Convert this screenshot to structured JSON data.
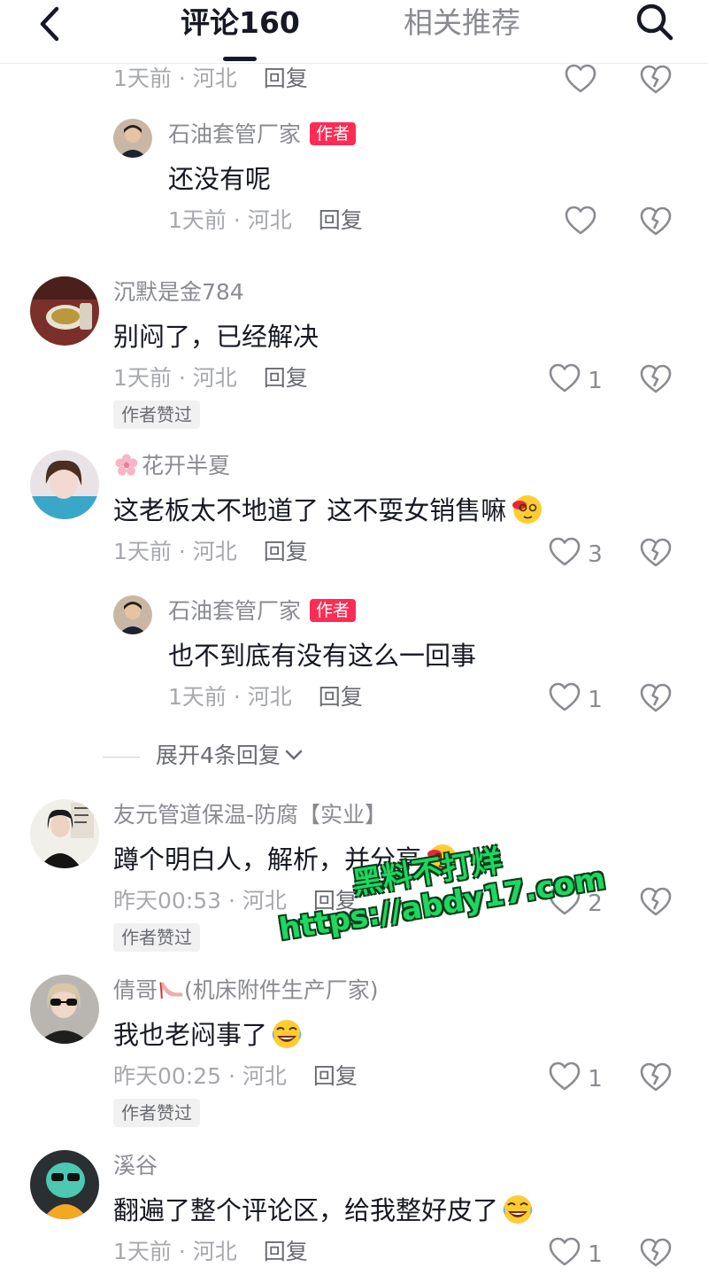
{
  "header": {
    "back_icon": "chevron-left-icon",
    "tab_comments": "评论160",
    "tab_related": "相关推荐",
    "search_icon": "search-icon"
  },
  "colors": {
    "author_badge": "#fe2c55",
    "text_primary": "#161823",
    "text_secondary": "#8a8b91",
    "watermark_fill": "#1ed760"
  },
  "top_partial": {
    "time": "1天前 · 河北",
    "reply_label": "回复"
  },
  "comments": [
    {
      "username": "石油套管厂家",
      "author_badge": "作者",
      "text": "还没有呢",
      "time": "1天前 · 河北",
      "reply_label": "回复",
      "likes": "",
      "is_reply": true
    },
    {
      "username": "沉默是金784",
      "text": "别闷了，已经解决",
      "time": "1天前 · 河北",
      "reply_label": "回复",
      "likes": "1",
      "liked_by_author": "作者赞过"
    },
    {
      "username_prefix_icon": "cherry-blossom-emoji",
      "username": "花开半夏",
      "text": "这老板太不地道了  这不耍女销售嘛",
      "text_emoji": "dizzy-face-emoji",
      "time": "1天前 · 河北",
      "reply_label": "回复",
      "likes": "3"
    },
    {
      "username": "石油套管厂家",
      "author_badge": "作者",
      "text": "也不到底有没有这么一回事",
      "time": "1天前 · 河北",
      "reply_label": "回复",
      "likes": "1",
      "is_reply": true
    },
    {
      "username": "友元管道保温-防腐【实业】",
      "text": "蹲个明白人，解析，并分享",
      "text_emoji": "dizzy-face-emoji",
      "time": "昨天00:53 · 河北",
      "reply_label": "回复",
      "likes": "2",
      "liked_by_author": "作者赞过"
    },
    {
      "username": "倩哥",
      "username_icon": "high-heel-emoji",
      "username_suffix": "(机床附件生产厂家)",
      "text": "我也老闷事了",
      "text_emoji": "rolling-laughing-emoji",
      "time": "昨天00:25 · 河北",
      "reply_label": "回复",
      "likes": "1",
      "liked_by_author": "作者赞过"
    },
    {
      "username": "溪谷",
      "text": "翻遍了整个评论区，给我整好皮了",
      "text_emoji": "rolling-laughing-emoji",
      "time": "1天前 · 河北",
      "reply_label": "回复",
      "likes": "1"
    }
  ],
  "expand_replies": "展开4条回复",
  "watermark": {
    "line1": "黑料不打烊",
    "line2": "https://abdy17.com"
  }
}
